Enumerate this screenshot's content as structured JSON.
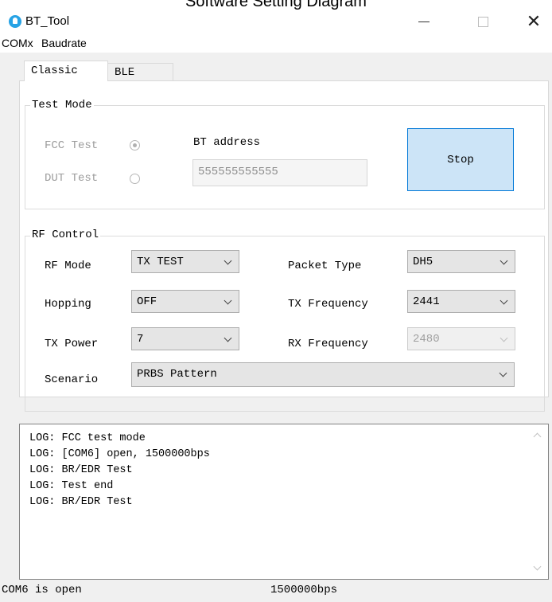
{
  "caption": "Software Setting Diagram",
  "window": {
    "title": "BT_Tool",
    "minimize_label": "—",
    "close_label": "✕"
  },
  "menu": {
    "items": [
      "COMx",
      "Baudrate"
    ]
  },
  "tabs": [
    "Classic",
    "BLE"
  ],
  "test_mode": {
    "title": "Test Mode",
    "fcc_label": "FCC Test",
    "fcc_selected": true,
    "dut_label": "DUT Test",
    "dut_selected": false,
    "bt_address_label": "BT address",
    "bt_address_value": "555555555555",
    "stop_label": "Stop"
  },
  "rf_control": {
    "title": "RF Control",
    "rf_mode_label": "RF Mode",
    "rf_mode_value": "TX TEST",
    "hopping_label": "Hopping",
    "hopping_value": "OFF",
    "tx_power_label": "TX Power",
    "tx_power_value": "7",
    "scenario_label": "Scenario",
    "scenario_value": "PRBS Pattern",
    "packet_type_label": "Packet Type",
    "packet_type_value": "DH5",
    "tx_frequency_label": "TX Frequency",
    "tx_frequency_value": "2441",
    "rx_frequency_label": "RX Frequency",
    "rx_frequency_value": "2480"
  },
  "log": {
    "lines": [
      "LOG: FCC test mode",
      "LOG: [COM6] open, 1500000bps",
      "LOG: BR/EDR Test",
      "LOG: Test end",
      "LOG: BR/EDR Test"
    ]
  },
  "status": {
    "port": "COM6 is open",
    "baud": "1500000bps"
  },
  "colors": {
    "accent_border": "#0078d7",
    "button_bg": "#cce4f7",
    "app_icon": "#27a3e5"
  }
}
